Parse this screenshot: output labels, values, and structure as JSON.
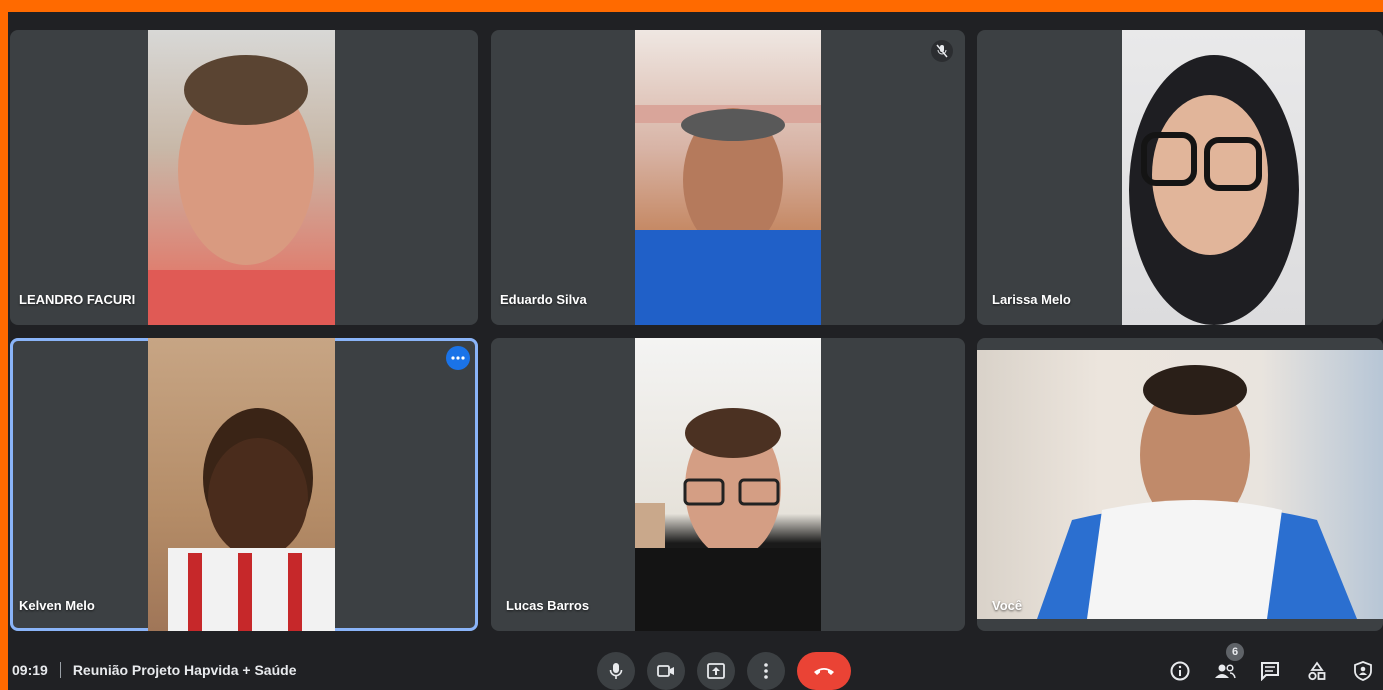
{
  "participants": [
    {
      "name": "LEANDRO FACURI"
    },
    {
      "name": "Eduardo Silva"
    },
    {
      "name": "Larissa Melo"
    },
    {
      "name": "Kelven Melo"
    },
    {
      "name": "Lucas Barros"
    },
    {
      "name": "Você"
    }
  ],
  "meeting": {
    "time": "09:19",
    "title": "Reunião Projeto Hapvida + Saúde"
  },
  "people_count": "6",
  "icons": [
    "microphone-icon",
    "camera-icon",
    "present-icon",
    "more-options-icon",
    "end-call-icon",
    "info-icon",
    "people-icon",
    "chat-icon",
    "activities-icon",
    "host-controls-icon",
    "muted-mic-icon"
  ],
  "colors": {
    "frame": "#ff6a00",
    "tile": "#3c4043",
    "background": "#202124",
    "end_call": "#ea4335",
    "active_outline": "#8ab4f8"
  }
}
